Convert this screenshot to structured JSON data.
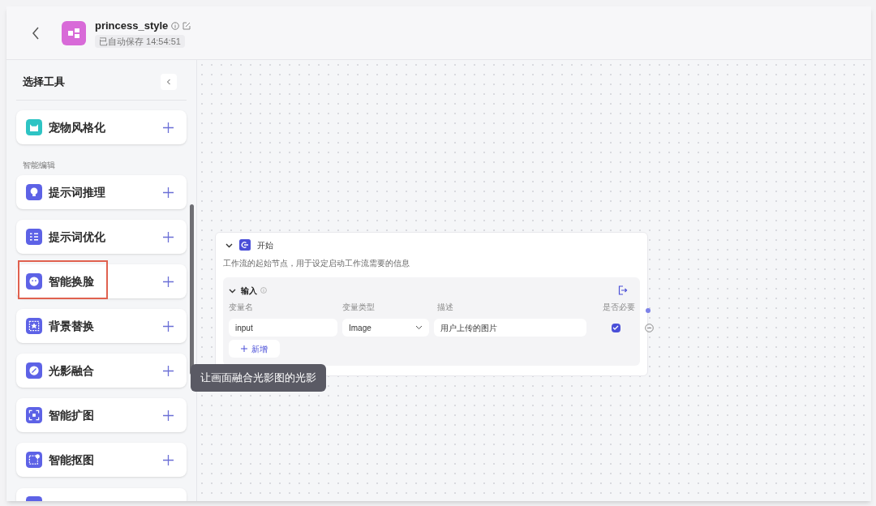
{
  "header": {
    "title": "princess_style",
    "autosave": "已自动保存 14:54:51"
  },
  "sidebar": {
    "title": "选择工具",
    "items": [
      {
        "kind": "pet",
        "label": "宠物风格化",
        "color": "#2ec4c4",
        "highlighted": false
      },
      {
        "kind": "section",
        "label": "智能编辑"
      },
      {
        "kind": "bulb",
        "label": "提示词推理",
        "color": "#5d62e6",
        "highlighted": false
      },
      {
        "kind": "list",
        "label": "提示词优化",
        "color": "#5d62e6",
        "highlighted": false
      },
      {
        "kind": "face",
        "label": "智能换脸",
        "color": "#5d62e6",
        "highlighted": true
      },
      {
        "kind": "scene",
        "label": "背景替换",
        "color": "#5d62e6",
        "highlighted": false
      },
      {
        "kind": "light",
        "label": "光影融合",
        "color": "#5d62e6",
        "highlighted": false,
        "tooltip": "让画面融合光影图的光影"
      },
      {
        "kind": "expand",
        "label": "智能扩图",
        "color": "#5d62e6",
        "highlighted": false
      },
      {
        "kind": "cutout",
        "label": "智能抠图",
        "color": "#5d62e6",
        "highlighted": false
      },
      {
        "kind": "stub"
      }
    ]
  },
  "node": {
    "title": "开始",
    "expanded": true,
    "description": "工作流的起始节点，用于设定启动工作流需要的信息",
    "input": {
      "title": "输入",
      "expanded": true,
      "columns": [
        "变量名",
        "变量类型",
        "描述",
        "是否必要"
      ],
      "rows": [
        {
          "name": "input",
          "type": "Image",
          "description": "用户上传的图片",
          "required": true
        }
      ],
      "add_button": "新增"
    }
  }
}
